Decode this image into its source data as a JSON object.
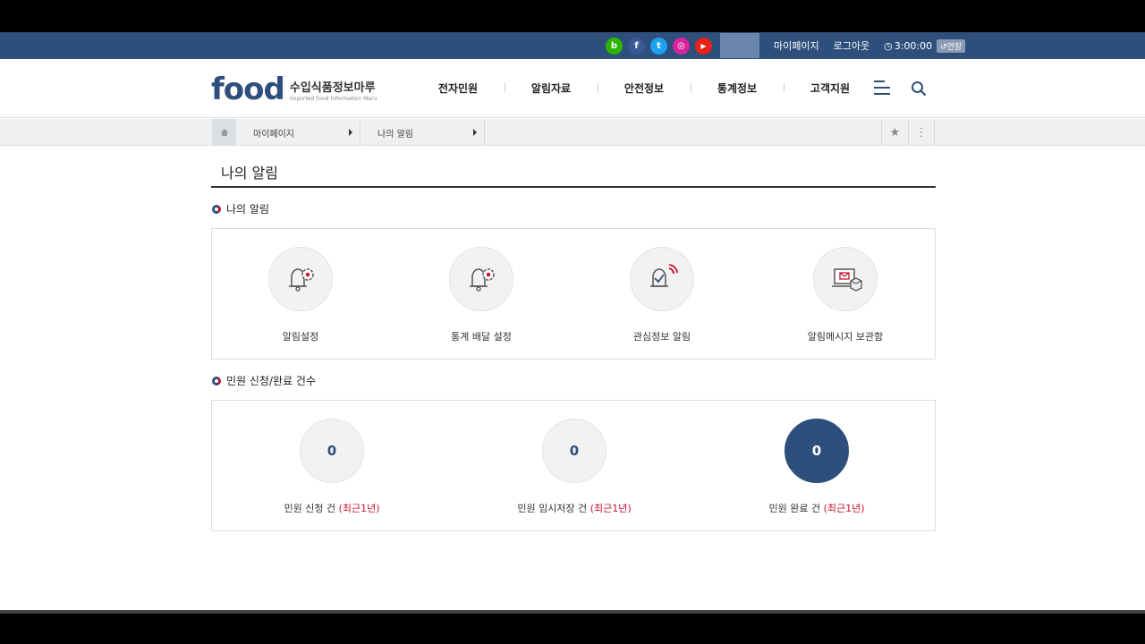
{
  "topbar": {
    "social": [
      {
        "name": "blog-icon",
        "glyph": "b",
        "color": "#2db400"
      },
      {
        "name": "facebook-icon",
        "glyph": "f",
        "color": "#3b5998"
      },
      {
        "name": "twitter-icon",
        "glyph": "t",
        "color": "#1da1f2"
      },
      {
        "name": "instagram-icon",
        "glyph": "◎",
        "color": "#d6249f"
      },
      {
        "name": "youtube-icon",
        "glyph": "▶",
        "color": "#e62117"
      }
    ],
    "mypage": "마이페이지",
    "logout": "로그아웃",
    "timer": "3:00:00",
    "extend": "연장"
  },
  "header": {
    "logo_main": "food",
    "logo_kr": "수입식품정보마루",
    "logo_en": "Imported Food Information Maru",
    "nav": [
      "전자민원",
      "알림자료",
      "안전정보",
      "통계정보",
      "고객지원"
    ]
  },
  "breadcrumb": {
    "items": [
      "마이페이지",
      "나의 알림"
    ]
  },
  "page": {
    "title": "나의 알림"
  },
  "alerts": {
    "title": "나의 알림",
    "items": [
      {
        "label": "알림설정",
        "icon": "bell-gear-icon"
      },
      {
        "label": "통계 배달 설정",
        "icon": "bell-gear-icon"
      },
      {
        "label": "관심정보 알림",
        "icon": "bell-star-icon"
      },
      {
        "label": "알림메시지 보관함",
        "icon": "message-box-icon"
      }
    ]
  },
  "counts": {
    "title": "민원 신청/완료 건수",
    "recent": "(최근1년)",
    "items": [
      {
        "value": "0",
        "label": "민원 신청 건"
      },
      {
        "value": "0",
        "label": "민원 임시저장 건"
      },
      {
        "value": "0",
        "label": "민원 완료 건"
      }
    ]
  },
  "colors": {
    "primary": "#2e4f7c",
    "accent": "#c8102e"
  }
}
